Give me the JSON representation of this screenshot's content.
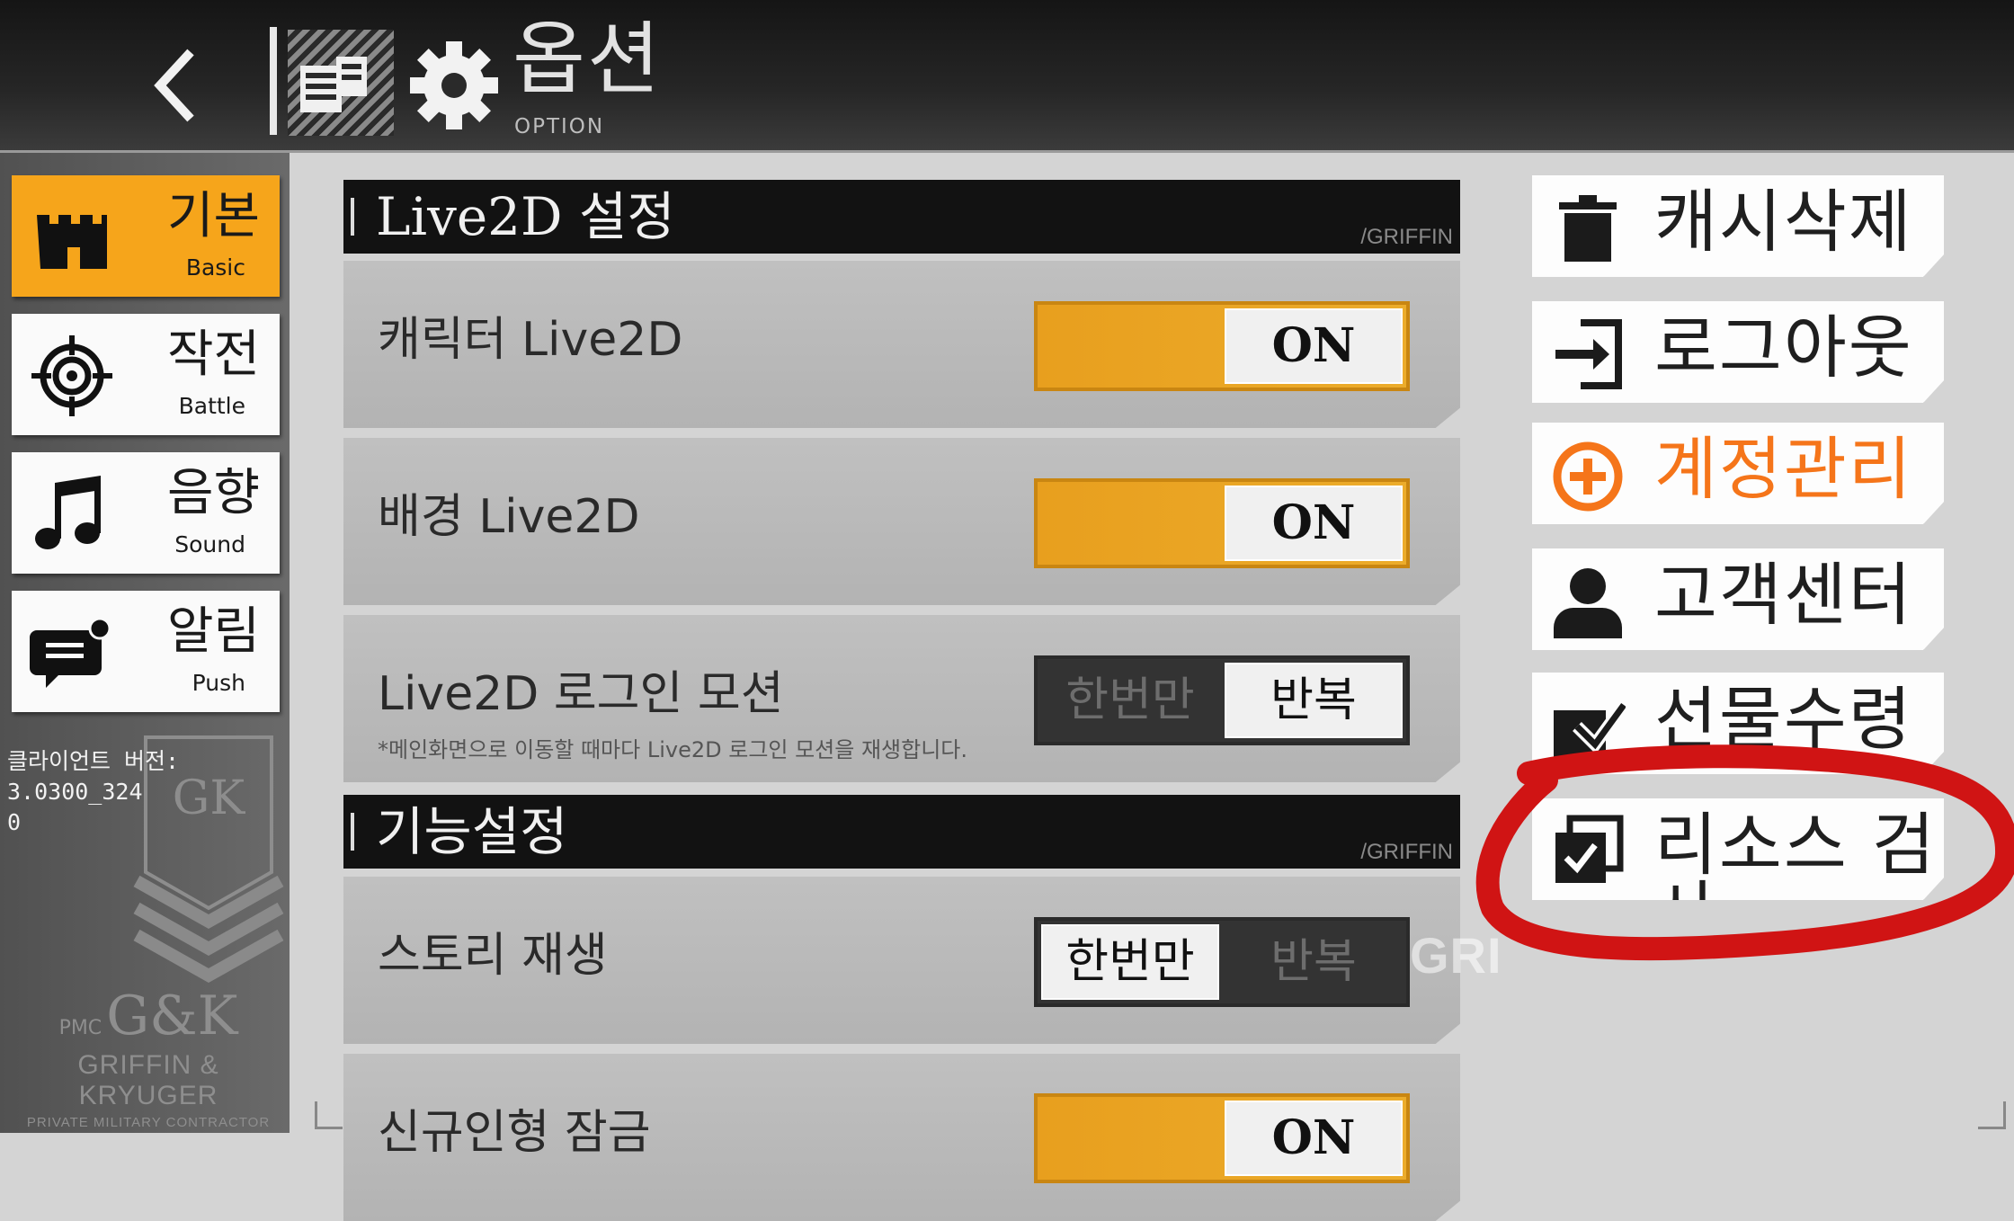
{
  "header": {
    "title": "옵션",
    "subtitle": "OPTION"
  },
  "sidebar": {
    "tabs": [
      {
        "label_ko": "기본",
        "label_en": "Basic",
        "icon": "castle-icon",
        "active": true
      },
      {
        "label_ko": "작전",
        "label_en": "Battle",
        "icon": "crosshair-icon",
        "active": false
      },
      {
        "label_ko": "음향",
        "label_en": "Sound",
        "icon": "music-note-icon",
        "active": false
      },
      {
        "label_ko": "알림",
        "label_en": "Push",
        "icon": "chat-bubble-icon",
        "active": false
      }
    ],
    "version_label": "클라이언트 버전:",
    "version_value": "3.0300_324",
    "version_extra": "0",
    "brand": {
      "mark": "G&K",
      "prefix": "PMC",
      "name": "GRIFFIN & KRYUGER",
      "sub": "PRIVATE MILITARY CONTRACTOR"
    }
  },
  "settings": {
    "section_live2d": {
      "title": "Live2D 설정",
      "tag": "/GRIFFIN"
    },
    "rows_live2d": [
      {
        "label": "캐릭터 Live2D",
        "control": "switch",
        "value": "ON"
      },
      {
        "label": "배경 Live2D",
        "control": "switch",
        "value": "ON"
      },
      {
        "label": "Live2D 로그인 모션",
        "note": "*메인화면으로 이동할 때마다 Live2D 로그인 모션을 재생합니다.",
        "control": "segmented",
        "options": [
          "한번만",
          "반복"
        ],
        "selected": "반복"
      }
    ],
    "section_function": {
      "title": "기능설정",
      "tag": "/GRIFFIN"
    },
    "rows_function": [
      {
        "label": "스토리 재생",
        "control": "segmented",
        "options": [
          "한번만",
          "반복"
        ],
        "selected": "한번만"
      },
      {
        "label": "신규인형 잠금",
        "control": "switch",
        "value": "ON"
      }
    ],
    "ghost_text": "GRI"
  },
  "actions": [
    {
      "label": "캐시삭제",
      "icon": "trash-icon"
    },
    {
      "label": "로그아웃",
      "icon": "logout-icon"
    },
    {
      "label": "계정관리",
      "icon": "plus-circle-icon",
      "accent": "#f5751a"
    },
    {
      "label": "고객센터",
      "icon": "person-icon"
    },
    {
      "label": "선물수령",
      "icon": "gift-check-icon"
    },
    {
      "label": "리소스 검사",
      "icon": "checklist-icon",
      "highlighted": true
    }
  ],
  "colors": {
    "active_tab": "#f6a51b",
    "toggle_on": "#e89f1e",
    "accent": "#f5751a",
    "highlight_ring": "#d01414"
  }
}
